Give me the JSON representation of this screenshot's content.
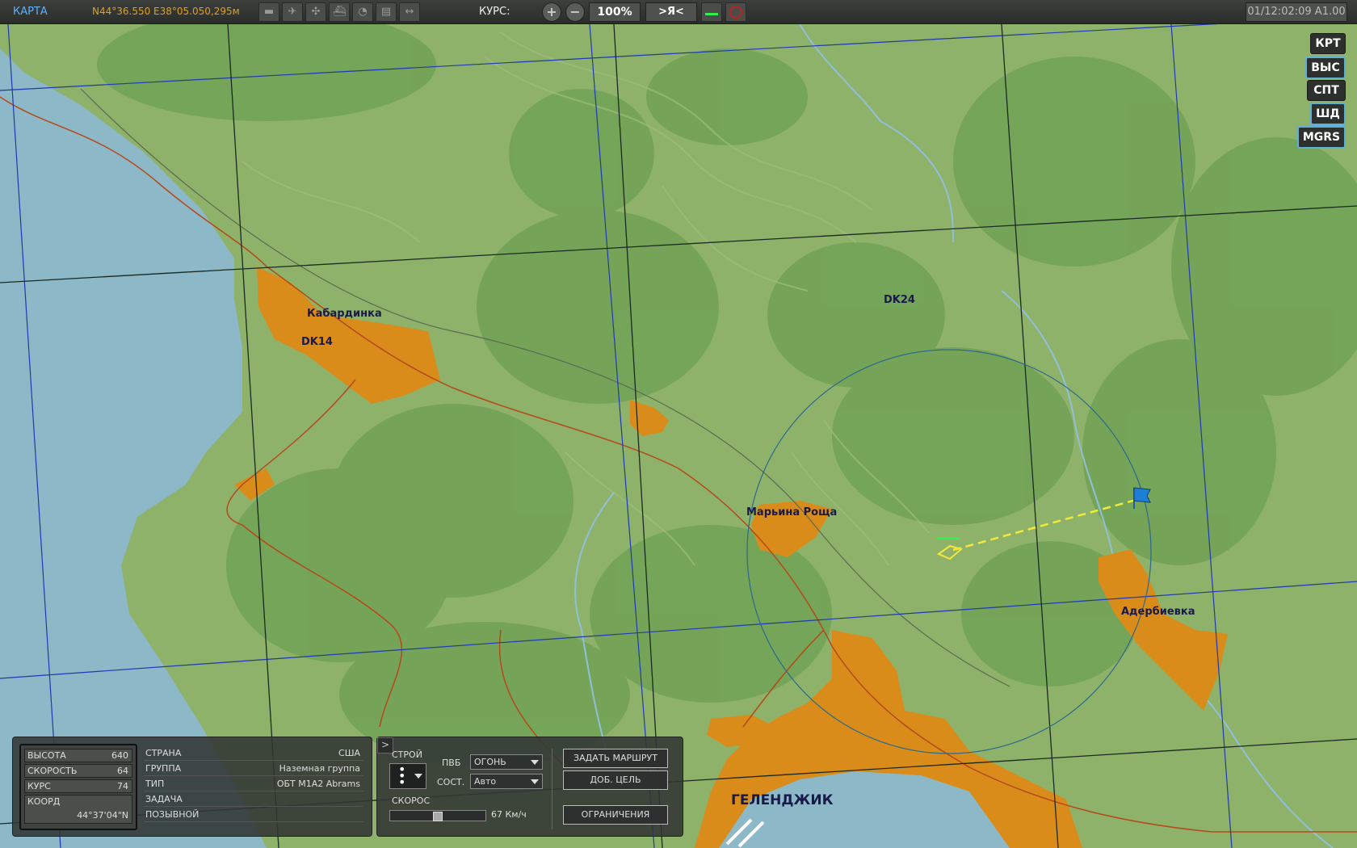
{
  "topbar": {
    "mode": "КАРТА",
    "coordinates": "N44°36.550 E38°05.050,295м",
    "course_label": "КУРС:",
    "zoom": "100%",
    "center_label": ">Я<",
    "time": "01/12:02:09 A1.00",
    "tool_icons": [
      "tank-icon",
      "plane-icon",
      "helicopter-icon",
      "ship-icon",
      "radar-icon",
      "message-icon",
      "ruler-icon"
    ]
  },
  "right_buttons": [
    {
      "label": "КРТ",
      "active": false
    },
    {
      "label": "ВЫС",
      "active": true
    },
    {
      "label": "СПТ",
      "active": false
    },
    {
      "label": "ШД",
      "active": true
    },
    {
      "label": "MGRS",
      "active": true
    }
  ],
  "map": {
    "labels": {
      "kabardinka": "Кабардинка",
      "dk14": "DK14",
      "dk24": "DK24",
      "maryina_roshcha": "Марьина Роща",
      "aderbievka": "Адербиевка",
      "gelendzhik": "ГЕЛЕНДЖИК"
    },
    "colors": {
      "sea": "#8cb8c8",
      "land": "#8fb26a",
      "forest": "#74a458",
      "town": "#d98c1a",
      "road": "#b5491a",
      "route": "#f2e83a",
      "waypoint_flag": "#1e7fd8"
    }
  },
  "unit_panel": {
    "stats": [
      {
        "label": "ВЫСОТА",
        "value": "640"
      },
      {
        "label": "СКОРОСТЬ",
        "value": "64"
      },
      {
        "label": "КУРС",
        "value": "74"
      }
    ],
    "coord_label": "КООРД",
    "coord_value": "44°37'04\"N",
    "info": [
      {
        "label": "СТРАНА",
        "value": "США"
      },
      {
        "label": "ГРУППА",
        "value": "Наземная группа"
      },
      {
        "label": "ТИП",
        "value": "ОБТ M1A2 Abrams"
      },
      {
        "label": "ЗАДАЧА",
        "value": ""
      },
      {
        "label": "ПОЗЫВНОЙ",
        "value": ""
      }
    ]
  },
  "order_panel": {
    "toggle": ">",
    "formation_label": "СТРОЙ",
    "roe_label": "ПВБ",
    "roe_value": "ОГОНЬ",
    "state_label": "СОСТ.",
    "state_value": "Авто",
    "speed_label": "СКОРОС",
    "speed_value": "67 Км/ч",
    "speed_fraction": 0.5,
    "buttons": {
      "set_route": "ЗАДАТЬ МАРШРУТ",
      "add_target": "ДОБ. ЦЕЛЬ",
      "limits": "ОГРАНИЧЕНИЯ"
    }
  }
}
